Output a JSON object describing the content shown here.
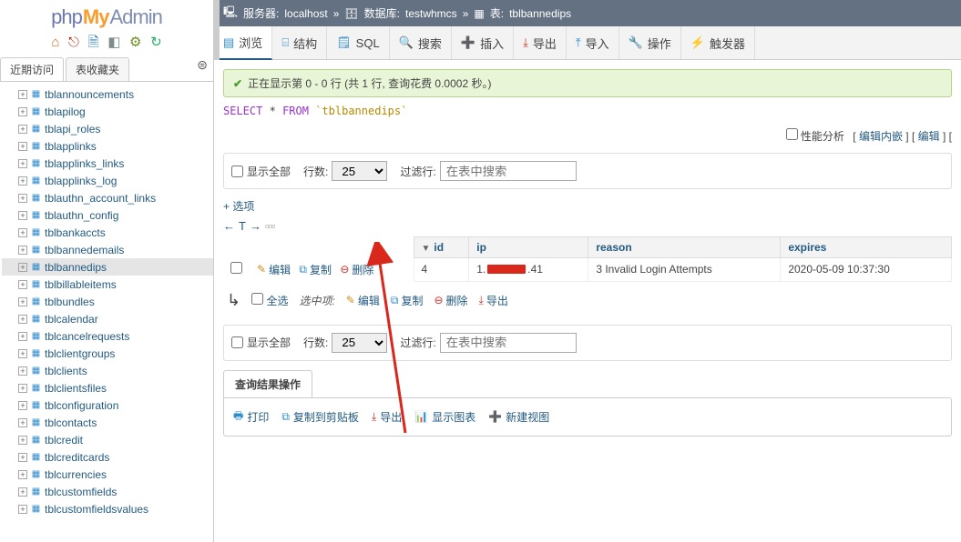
{
  "logo": {
    "php": "php",
    "my": "My",
    "admin": "Admin"
  },
  "sidebar": {
    "tabs": [
      "近期访问",
      "表收藏夹"
    ],
    "items": [
      {
        "label": "tblannouncements"
      },
      {
        "label": "tblapilog"
      },
      {
        "label": "tblapi_roles"
      },
      {
        "label": "tblapplinks"
      },
      {
        "label": "tblapplinks_links"
      },
      {
        "label": "tblapplinks_log"
      },
      {
        "label": "tblauthn_account_links"
      },
      {
        "label": "tblauthn_config"
      },
      {
        "label": "tblbankaccts"
      },
      {
        "label": "tblbannedemails"
      },
      {
        "label": "tblbannedips",
        "selected": true
      },
      {
        "label": "tblbillableitems"
      },
      {
        "label": "tblbundles"
      },
      {
        "label": "tblcalendar"
      },
      {
        "label": "tblcancelrequests"
      },
      {
        "label": "tblclientgroups"
      },
      {
        "label": "tblclients"
      },
      {
        "label": "tblclientsfiles"
      },
      {
        "label": "tblconfiguration"
      },
      {
        "label": "tblcontacts"
      },
      {
        "label": "tblcredit"
      },
      {
        "label": "tblcreditcards"
      },
      {
        "label": "tblcurrencies"
      },
      {
        "label": "tblcustomfields"
      },
      {
        "label": "tblcustomfieldsvalues"
      }
    ]
  },
  "breadcrumb": {
    "server_label": "服务器:",
    "server": "localhost",
    "db_label": "数据库:",
    "db": "testwhmcs",
    "table_label": "表:",
    "table": "tblbannedips"
  },
  "tabs": {
    "browse": "浏览",
    "structure": "结构",
    "sql": "SQL",
    "search": "搜索",
    "insert": "插入",
    "export": "导出",
    "import": "导入",
    "operations": "操作",
    "triggers": "触发器"
  },
  "notice": "正在显示第 0 - 0 行 (共 1 行, 查询花费 0.0002 秒。)",
  "sql": {
    "select": "SELECT",
    "star": "*",
    "from": "FROM",
    "table": "`tblbannedips`"
  },
  "profiling": {
    "checkbox_label": "性能分析",
    "edit_inline": "编辑内嵌",
    "edit": "编辑",
    "more": "["
  },
  "filter": {
    "show_all": "显示全部",
    "rows_label": "行数:",
    "rows_value": "25",
    "filter_label": "过滤行:",
    "placeholder": "在表中搜索"
  },
  "extra": "+ 选项",
  "sorter": {
    "left": "←",
    "t": "T",
    "right": "→"
  },
  "columns": {
    "id": "id",
    "ip": "ip",
    "reason": "reason",
    "expires": "expires"
  },
  "row_actions": {
    "edit": "编辑",
    "copy": "复制",
    "delete": "删除"
  },
  "row": {
    "id": "4",
    "ip_prefix": "1.",
    "ip_suffix": ".41",
    "reason": "3 Invalid Login Attempts",
    "expires": "2020-05-09 10:37:30"
  },
  "selectbar": {
    "checkall": "全选",
    "with_selected": "选中项:",
    "edit": "编辑",
    "copy": "复制",
    "delete": "删除",
    "export": "导出"
  },
  "result_ops": {
    "title": "查询结果操作",
    "print": "打印",
    "copy_clipboard": "复制到剪贴板",
    "export": "导出",
    "chart": "显示图表",
    "create_view": "新建视图"
  }
}
